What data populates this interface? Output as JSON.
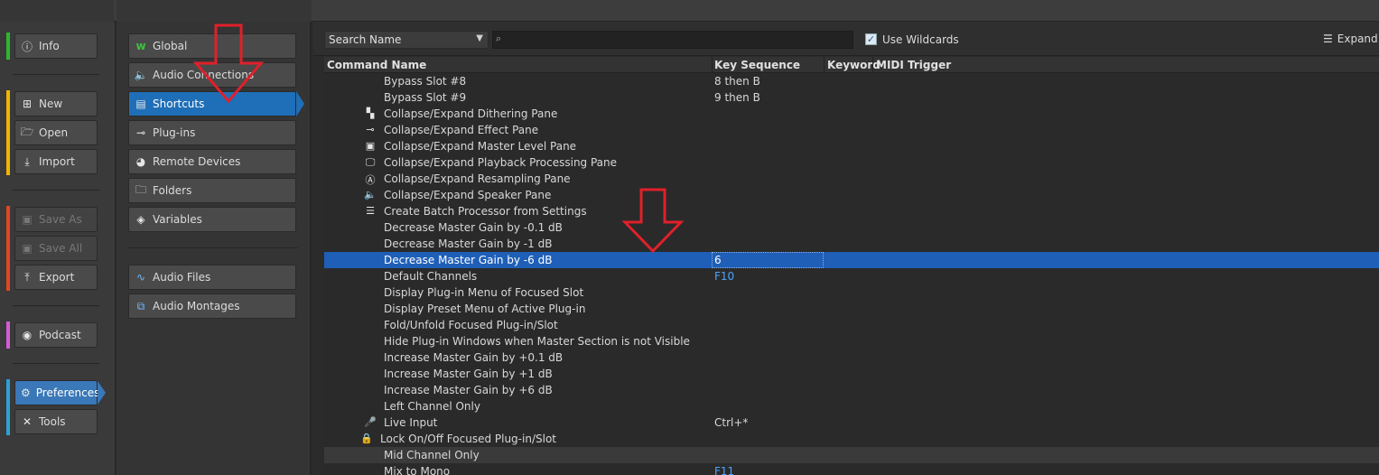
{
  "sidebar": {
    "groups": [
      {
        "color": "#2fb52f",
        "items": [
          {
            "label": "Info",
            "icon": "info-icon",
            "state": "normal"
          }
        ]
      },
      {
        "color": "#f0b400",
        "items": [
          {
            "label": "New",
            "icon": "new-icon",
            "state": "normal"
          },
          {
            "label": "Open",
            "icon": "open-folder-icon",
            "state": "normal"
          },
          {
            "label": "Import",
            "icon": "import-icon",
            "state": "normal"
          }
        ]
      },
      {
        "color": "#e2471f",
        "items": [
          {
            "label": "Save As",
            "icon": "save-as-icon",
            "state": "disabled"
          },
          {
            "label": "Save All",
            "icon": "save-all-icon",
            "state": "disabled"
          },
          {
            "label": "Export",
            "icon": "export-icon",
            "state": "normal"
          }
        ]
      },
      {
        "color": "#d65bd6",
        "items": [
          {
            "label": "Podcast",
            "icon": "podcast-icon",
            "state": "normal"
          }
        ]
      },
      {
        "color": "#2aa0d6",
        "items": [
          {
            "label": "Preferences",
            "icon": "gear-icon",
            "state": "active"
          },
          {
            "label": "Tools",
            "icon": "tools-icon",
            "state": "normal"
          }
        ]
      }
    ]
  },
  "prefs_nav": {
    "items": [
      {
        "label": "Global",
        "icon": "wavelab-icon",
        "state": "normal"
      },
      {
        "label": "Audio Connections",
        "icon": "speaker-icon",
        "state": "normal"
      },
      {
        "label": "Shortcuts",
        "icon": "keyboard-icon",
        "state": "active"
      },
      {
        "label": "Plug-ins",
        "icon": "plugin-icon",
        "state": "normal"
      },
      {
        "label": "Remote Devices",
        "icon": "remote-icon",
        "state": "normal"
      },
      {
        "label": "Folders",
        "icon": "folder-icon",
        "state": "normal"
      },
      {
        "label": "Variables",
        "icon": "tag-icon",
        "state": "normal"
      }
    ],
    "files": [
      {
        "label": "Audio Files",
        "icon": "waveform-icon"
      },
      {
        "label": "Audio Montages",
        "icon": "montage-icon"
      }
    ]
  },
  "toolbar": {
    "search_mode": "Search Name",
    "search_value": "",
    "use_wildcards_label": "Use Wildcards",
    "use_wildcards_checked": true,
    "expand_label": "Expand"
  },
  "table": {
    "headers": [
      "Command Name",
      "Key Sequence",
      "Keyword",
      "MIDI Trigger"
    ],
    "rows": [
      {
        "name": "Bypass Slot #8",
        "key": "8 then B",
        "icon": ""
      },
      {
        "name": "Bypass Slot #9",
        "key": "9 then B",
        "icon": ""
      },
      {
        "name": "Collapse/Expand Dithering Pane",
        "key": "",
        "icon": "dithering-icon"
      },
      {
        "name": "Collapse/Expand Effect Pane",
        "key": "",
        "icon": "effect-icon"
      },
      {
        "name": "Collapse/Expand Master Level Pane",
        "key": "",
        "icon": "master-level-icon"
      },
      {
        "name": "Collapse/Expand Playback Processing Pane",
        "key": "",
        "icon": "playback-icon"
      },
      {
        "name": "Collapse/Expand Resampling Pane",
        "key": "",
        "icon": "resampling-icon"
      },
      {
        "name": "Collapse/Expand Speaker Pane",
        "key": "",
        "icon": "speaker-icon"
      },
      {
        "name": "Create Batch Processor from Settings",
        "key": "",
        "icon": "batch-icon"
      },
      {
        "name": "Decrease Master Gain by -0.1 dB",
        "key": "",
        "icon": ""
      },
      {
        "name": "Decrease Master Gain by -1 dB",
        "key": "",
        "icon": ""
      },
      {
        "name": "Decrease Master Gain by -6 dB",
        "key": "6",
        "icon": "",
        "selected": true
      },
      {
        "name": "Default Channels",
        "key": "F10",
        "icon": "",
        "key_blue": true
      },
      {
        "name": "Display Plug-in Menu of Focused Slot",
        "key": "",
        "icon": ""
      },
      {
        "name": "Display Preset Menu of Active Plug-in",
        "key": "",
        "icon": ""
      },
      {
        "name": "Fold/Unfold Focused Plug-in/Slot",
        "key": "",
        "icon": ""
      },
      {
        "name": "Hide Plug-in Windows when Master Section is not Visible",
        "key": "",
        "icon": ""
      },
      {
        "name": "Increase Master Gain by +0.1 dB",
        "key": "",
        "icon": ""
      },
      {
        "name": "Increase Master Gain by +1 dB",
        "key": "",
        "icon": ""
      },
      {
        "name": "Increase Master Gain by +6 dB",
        "key": "",
        "icon": ""
      },
      {
        "name": "Left Channel Only",
        "key": "",
        "icon": ""
      },
      {
        "name": "Live Input",
        "key": "Ctrl+*",
        "icon": "microphone-icon"
      },
      {
        "name": "Lock On/Off Focused Plug-in/Slot",
        "key": "",
        "icon": "lock-icon"
      },
      {
        "name": "Mid Channel Only",
        "key": "",
        "icon": "",
        "highlight": true
      },
      {
        "name": "Mix to Mono",
        "key": "F11",
        "icon": "",
        "key_blue": true
      }
    ]
  },
  "annotations": {
    "arrow_color": "#e0202a"
  }
}
